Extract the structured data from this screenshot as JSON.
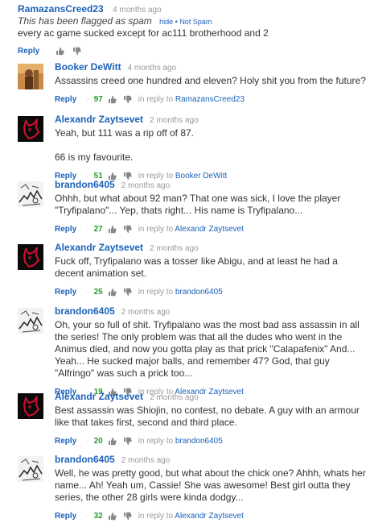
{
  "first": {
    "author": "RamazansCreed23",
    "time": "4 months ago",
    "flag_text": "This has been flagged as spam",
    "hide": "hide",
    "not_spam": "Not Spam",
    "text": "every ac game sucked except for  ac111 brotherhood and 2",
    "reply": "Reply"
  },
  "comments": [
    {
      "author": "Booker DeWitt",
      "time": "4 months ago",
      "text": "Assassins creed one hundred and eleven? Holy shit you from the future?",
      "likes": "97",
      "in_reply_prefix": "in reply to",
      "in_reply_to": "RamazansCreed23",
      "reply": "Reply"
    },
    {
      "author": "Alexandr Zaytsevet",
      "time": "2 months ago",
      "text": "Yeah, but 111 was a rip off of 87.\n\n66 is my favourite.",
      "likes": "51",
      "in_reply_prefix": "in reply to",
      "in_reply_to": "Booker DeWitt",
      "reply": "Reply"
    },
    {
      "author": "brandon6405",
      "time": "2 months ago",
      "text": "Ohhh, but what about 92 man? That one was sick, I love the player \"Tryfipalano\"... Yep, thats right... His name is Tryfipalano...",
      "likes": "27",
      "in_reply_prefix": "in reply to",
      "in_reply_to": "Alexandr Zaytsevet",
      "reply": "Reply"
    },
    {
      "author": "Alexandr Zaytsevet",
      "time": "2 months ago",
      "text": "Fuck off, Tryfipalano was a tosser like Abigu, and at least he had a decent animation set.",
      "likes": "25",
      "in_reply_prefix": "in reply to",
      "in_reply_to": "brandon6405",
      "reply": "Reply"
    },
    {
      "author": "brandon6405",
      "time": "2 months ago",
      "text": "Oh, your so full of shit. Tryfipalano was the most bad ass assassin in all the series! The only problem was that all the dudes who went in the Animus died, and now you gotta play as that prick \"Calapafenix\" And... Yeah... He sucked major balls, and remember 47? God, that guy \"Alfringo\" was such a prick too...",
      "likes": "19",
      "in_reply_prefix": "in reply to",
      "in_reply_to": "Alexandr Zaytsevet",
      "reply": "Reply"
    },
    {
      "author": "Alexandr Zaytsevet",
      "time": "2 months ago",
      "text": "Best assassin was Shiojin, no contest, no debate. A guy with an armour like that takes first, second and third place.",
      "likes": "20",
      "in_reply_prefix": "in reply to",
      "in_reply_to": "brandon6405",
      "reply": "Reply"
    },
    {
      "author": "brandon6405",
      "time": "2 months ago",
      "text": "Well, he was pretty good, but what about the chick one? Ahhh, whats her name... Ah! Yeah um, Cassie! She was awesome! Best girl outta they series, the other 28 girls were kinda dodgy...",
      "likes": "32",
      "in_reply_prefix": "in reply to",
      "in_reply_to": "Alexandr Zaytsevet",
      "reply": "Reply"
    }
  ],
  "icons": {
    "like": "thumbs-up-icon",
    "dislike": "thumbs-down-icon"
  },
  "colors": {
    "link": "#1c62b9",
    "likes": "#2a9a2a",
    "meta": "#999999"
  }
}
